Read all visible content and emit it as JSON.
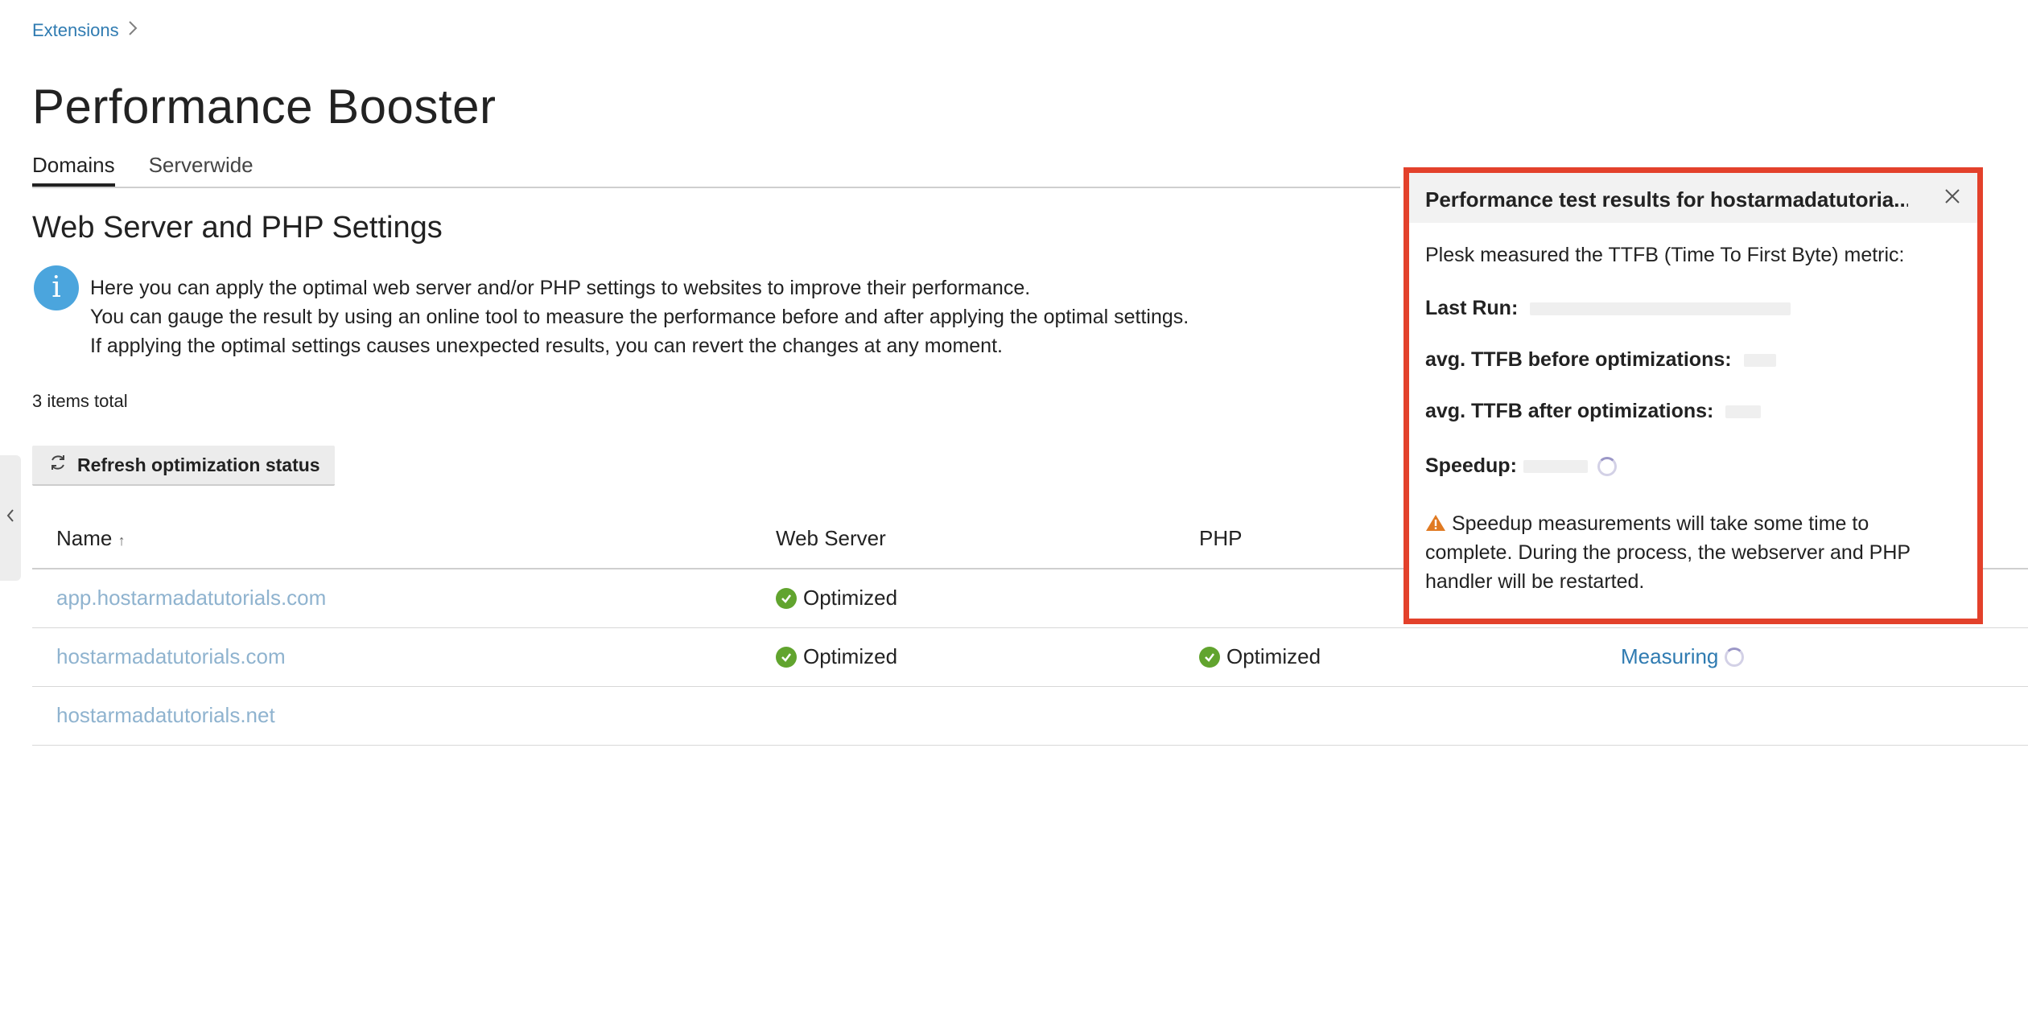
{
  "breadcrumb": {
    "label": "Extensions",
    "chevron": "chevron-right-icon"
  },
  "page": {
    "title": "Performance Booster"
  },
  "tabs": [
    {
      "label": "Domains",
      "active": true
    },
    {
      "label": "Serverwide",
      "active": false
    }
  ],
  "section": {
    "title": "Web Server and PHP Settings",
    "info_lines": [
      "Here you can apply the optimal web server and/or PHP settings to websites to improve their performance.",
      "You can gauge the result by using an online tool to measure the performance before and after applying the optimal settings.",
      "If applying the optimal settings causes unexpected results, you can revert the changes at any moment."
    ],
    "info_icon": "i"
  },
  "items_total": "3 items total",
  "toolbar": {
    "refresh_label": "Refresh optimization status"
  },
  "table": {
    "columns": {
      "name": "Name",
      "sort_arrow": "↑",
      "web_server": "Web Server",
      "php": "PHP"
    },
    "rows": [
      {
        "name": "app.hostarmadatutorials.com",
        "web_server": "Optimized",
        "php": "",
        "status": ""
      },
      {
        "name": "hostarmadatutorials.com",
        "web_server": "Optimized",
        "php": "Optimized",
        "status": "Measuring"
      },
      {
        "name": "hostarmadatutorials.net",
        "web_server": "",
        "php": "",
        "status": ""
      }
    ]
  },
  "popover": {
    "title": "Performance test results for hostarmadatutoria...",
    "intro": "Plesk measured the TTFB (Time To First Byte) metric:",
    "last_run_label": "Last Run:",
    "before_label": "avg. TTFB before optimizations:",
    "after_label": "avg. TTFB after optimizations:",
    "speedup_label": "Speedup:",
    "warning": "Speedup measurements will take some time to complete. During the process, the webserver and PHP handler will be restarted."
  },
  "colors": {
    "highlight_border": "#e3412b",
    "link": "#2f7bb1",
    "ok": "#61a42e",
    "info": "#4ba5dd",
    "warning": "#e07a22"
  }
}
